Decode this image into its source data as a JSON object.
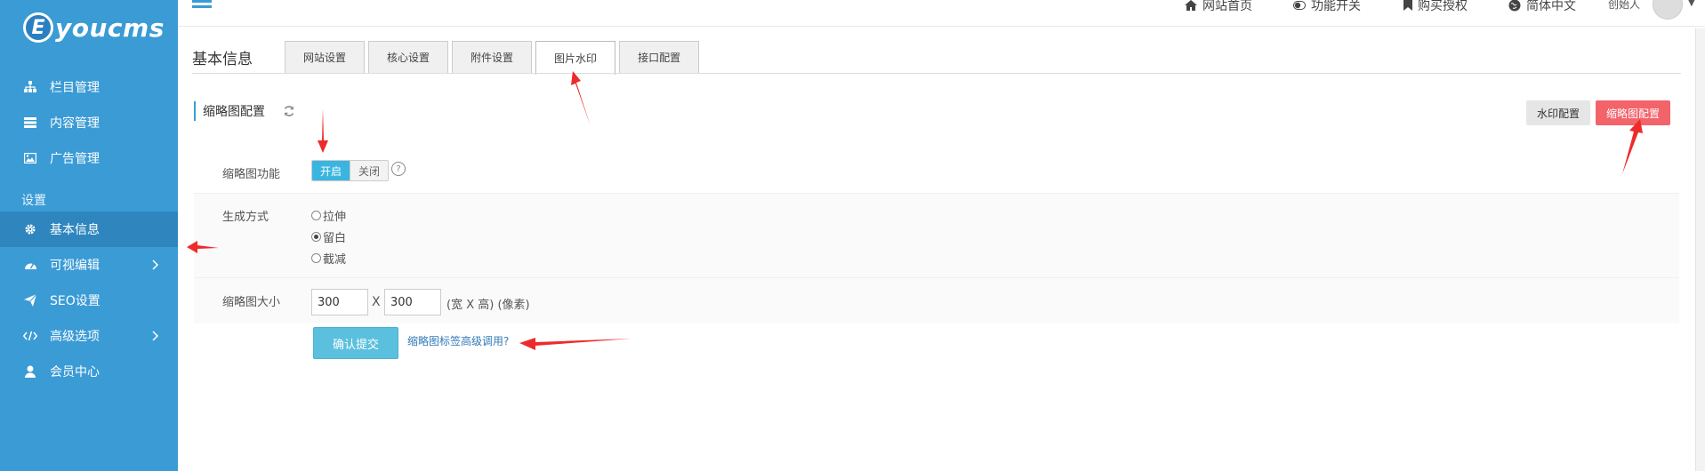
{
  "sidebar": {
    "logo_letter": "E",
    "logo_text": "youcms",
    "items": [
      {
        "label": "栏目管理",
        "icon": "sitemap-icon"
      },
      {
        "label": "内容管理",
        "icon": "list-icon"
      },
      {
        "label": "广告管理",
        "icon": "image-icon"
      }
    ],
    "section_label": "设置",
    "settings_items": [
      {
        "label": "基本信息",
        "icon": "gear-icon",
        "active": true
      },
      {
        "label": "可视编辑",
        "icon": "dashboard-icon",
        "has_children": true
      },
      {
        "label": "SEO设置",
        "icon": "send-icon"
      },
      {
        "label": "高级选项",
        "icon": "code-icon",
        "has_children": true
      },
      {
        "label": "会员中心",
        "icon": "user-icon"
      }
    ]
  },
  "topbar": {
    "links": [
      {
        "label": "网站首页",
        "icon": "home-icon"
      },
      {
        "label": "功能开关",
        "icon": "toggle-icon"
      },
      {
        "label": "购买授权",
        "icon": "bookmark-icon"
      },
      {
        "label": "简体中文",
        "icon": "globe-icon"
      }
    ],
    "user_role": "创始人"
  },
  "page": {
    "title": "基本信息",
    "tabs": [
      {
        "label": "网站设置"
      },
      {
        "label": "核心设置"
      },
      {
        "label": "附件设置"
      },
      {
        "label": "图片水印",
        "active": true
      },
      {
        "label": "接口配置"
      }
    ],
    "section_title": "缩略图配置",
    "btn_watermark": "水印配置",
    "btn_thumb": "缩略图配置"
  },
  "form": {
    "thumb_label": "缩略图功能",
    "toggle_on": "开启",
    "toggle_off": "关闭",
    "help": "?",
    "mode_label": "生成方式",
    "modes": [
      {
        "label": "拉伸",
        "checked": false
      },
      {
        "label": "留白",
        "checked": true
      },
      {
        "label": "截减",
        "checked": false
      }
    ],
    "size_label": "缩略图大小",
    "width": "300",
    "height": "300",
    "x_sep": "X",
    "unit_text": "(宽 X 高) (像素)",
    "submit": "确认提交",
    "advanced_link": "缩略图标签高级调用?"
  },
  "colors": {
    "sidebar_bg": "#3a9bd5",
    "accent_red": "#f3636a",
    "toggle_on": "#3ab5e0",
    "arrow": "#ee2a2a"
  }
}
